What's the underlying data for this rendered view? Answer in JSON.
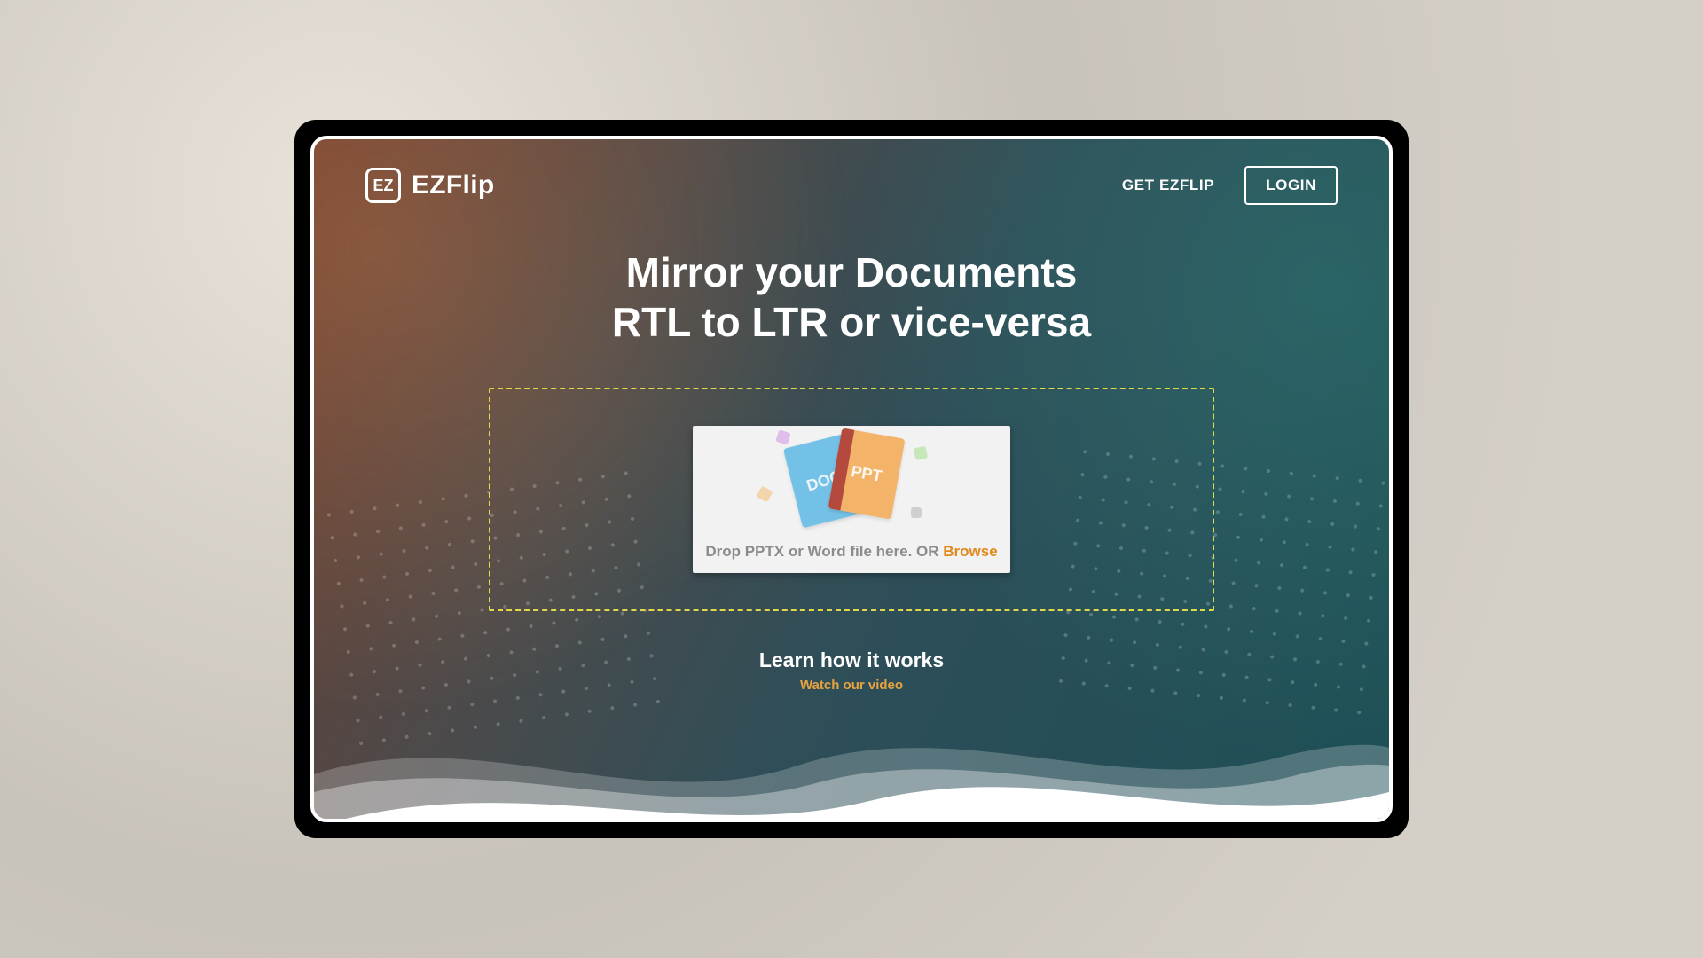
{
  "brand": {
    "name": "EZFlip",
    "logo_text": "EZ"
  },
  "nav": {
    "get_link": "GET EZFLIP",
    "login": "LOGIN"
  },
  "hero": {
    "line1": "Mirror your Documents",
    "line2": "RTL to LTR or vice-versa"
  },
  "dropzone": {
    "doc_label": "DOC",
    "ppt_label": "PPT",
    "caption_prefix": "Drop PPTX or Word file here. OR ",
    "browse": "Browse"
  },
  "learn": {
    "title": "Learn how it works",
    "link": "Watch our video"
  },
  "colors": {
    "accent": "#e8a341",
    "dash": "#e2d94a"
  }
}
